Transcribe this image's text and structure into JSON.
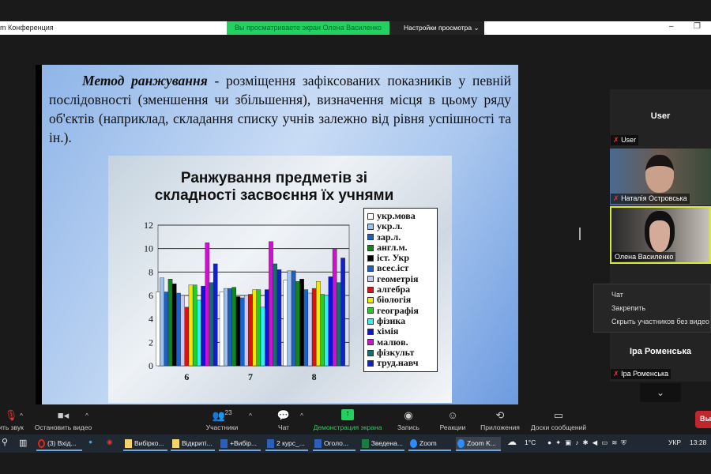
{
  "window": {
    "title": "m Конференция",
    "banner": "Вы просматриваете экран Олена Василенко",
    "view_settings": "Настройки просмотра"
  },
  "slide": {
    "term": "Метод ранжування",
    "text": " - розміщення зафіксованих показників у певній послідовності (зменшення чи збільшення), визначення місця в цьому ряду об'єктів (наприклад, складання списку учнів залежно від рівня успішності та ін.)."
  },
  "chart_data": {
    "type": "bar",
    "title": "Ранжування предметів зі складності засвоєння їх учнями",
    "categories": [
      "6",
      "7",
      "8"
    ],
    "ylim": [
      0,
      12
    ],
    "yticks": [
      "0",
      "2",
      "4",
      "6",
      "8",
      "10",
      "12"
    ],
    "legend_position": "right",
    "series": [
      {
        "name": "укр.мова",
        "color": "#ffffff",
        "values": [
          6.3,
          6.3,
          7.3
        ]
      },
      {
        "name": "укр.л.",
        "color": "#9cc3f0",
        "values": [
          7.5,
          6.6,
          8.1
        ]
      },
      {
        "name": "зар.л.",
        "color": "#1f5fc0",
        "values": [
          6.3,
          6.6,
          8.1
        ]
      },
      {
        "name": "англ.м.",
        "color": "#0a8a1a",
        "values": [
          7.4,
          6.7,
          7.2
        ]
      },
      {
        "name": "іст. Укр",
        "color": "#000000",
        "values": [
          7.0,
          5.9,
          7.4
        ]
      },
      {
        "name": "всес.іст",
        "color": "#1463d0",
        "values": [
          6.2,
          5.8,
          6.5
        ]
      },
      {
        "name": "геометрія",
        "color": "#c8c8f0",
        "values": [
          6.0,
          6.0,
          6.2
        ]
      },
      {
        "name": "алгебра",
        "color": "#e01010",
        "values": [
          5.0,
          6.1,
          6.6
        ]
      },
      {
        "name": "біологія",
        "color": "#f5e800",
        "values": [
          6.9,
          6.5,
          7.2
        ]
      },
      {
        "name": "географія",
        "color": "#20d020",
        "values": [
          6.9,
          6.5,
          6.1
        ]
      },
      {
        "name": "фізика",
        "color": "#30f0f0",
        "values": [
          5.6,
          5.0,
          6.0
        ]
      },
      {
        "name": "хімія",
        "color": "#1010e0",
        "values": [
          6.8,
          6.5,
          7.6
        ]
      },
      {
        "name": "малюв.",
        "color": "#d010d0",
        "values": [
          10.5,
          10.6,
          10.0
        ]
      },
      {
        "name": "фізкульт",
        "color": "#107070",
        "values": [
          7.1,
          8.7,
          7.1
        ]
      },
      {
        "name": "труд.навч",
        "color": "#1020d0",
        "values": [
          8.7,
          8.2,
          9.2
        ]
      }
    ]
  },
  "participants": {
    "top_name": "User",
    "tiles": [
      {
        "name": "User"
      },
      {
        "name": "Наталія Островська"
      },
      {
        "name": "Олена Василенко"
      },
      {
        "name": "Іра Роменська",
        "big": "Іра Роменська"
      }
    ]
  },
  "context_menu": [
    "Чат",
    "Закрепить",
    "Скрыть участников без видео"
  ],
  "toolbar": {
    "audio": "ить звук",
    "video": "Остановить видео",
    "participants": "Участники",
    "participants_count": "23",
    "chat": "Чат",
    "share": "Демонстрация экрана",
    "record": "Запись",
    "reactions": "Реакции",
    "apps": "Приложения",
    "whiteboards": "Доски сообщений",
    "leave": "Вы"
  },
  "taskbar": {
    "items": [
      "(3) Вхід...",
      "Вибірко...",
      "Відкриті...",
      "+Вибір...",
      "2 курс_...",
      "Оголо...",
      "Зведена...",
      "Zoom",
      "Zoom K..."
    ],
    "temp": "1°C",
    "lang": "УКР",
    "time": "13:28"
  }
}
